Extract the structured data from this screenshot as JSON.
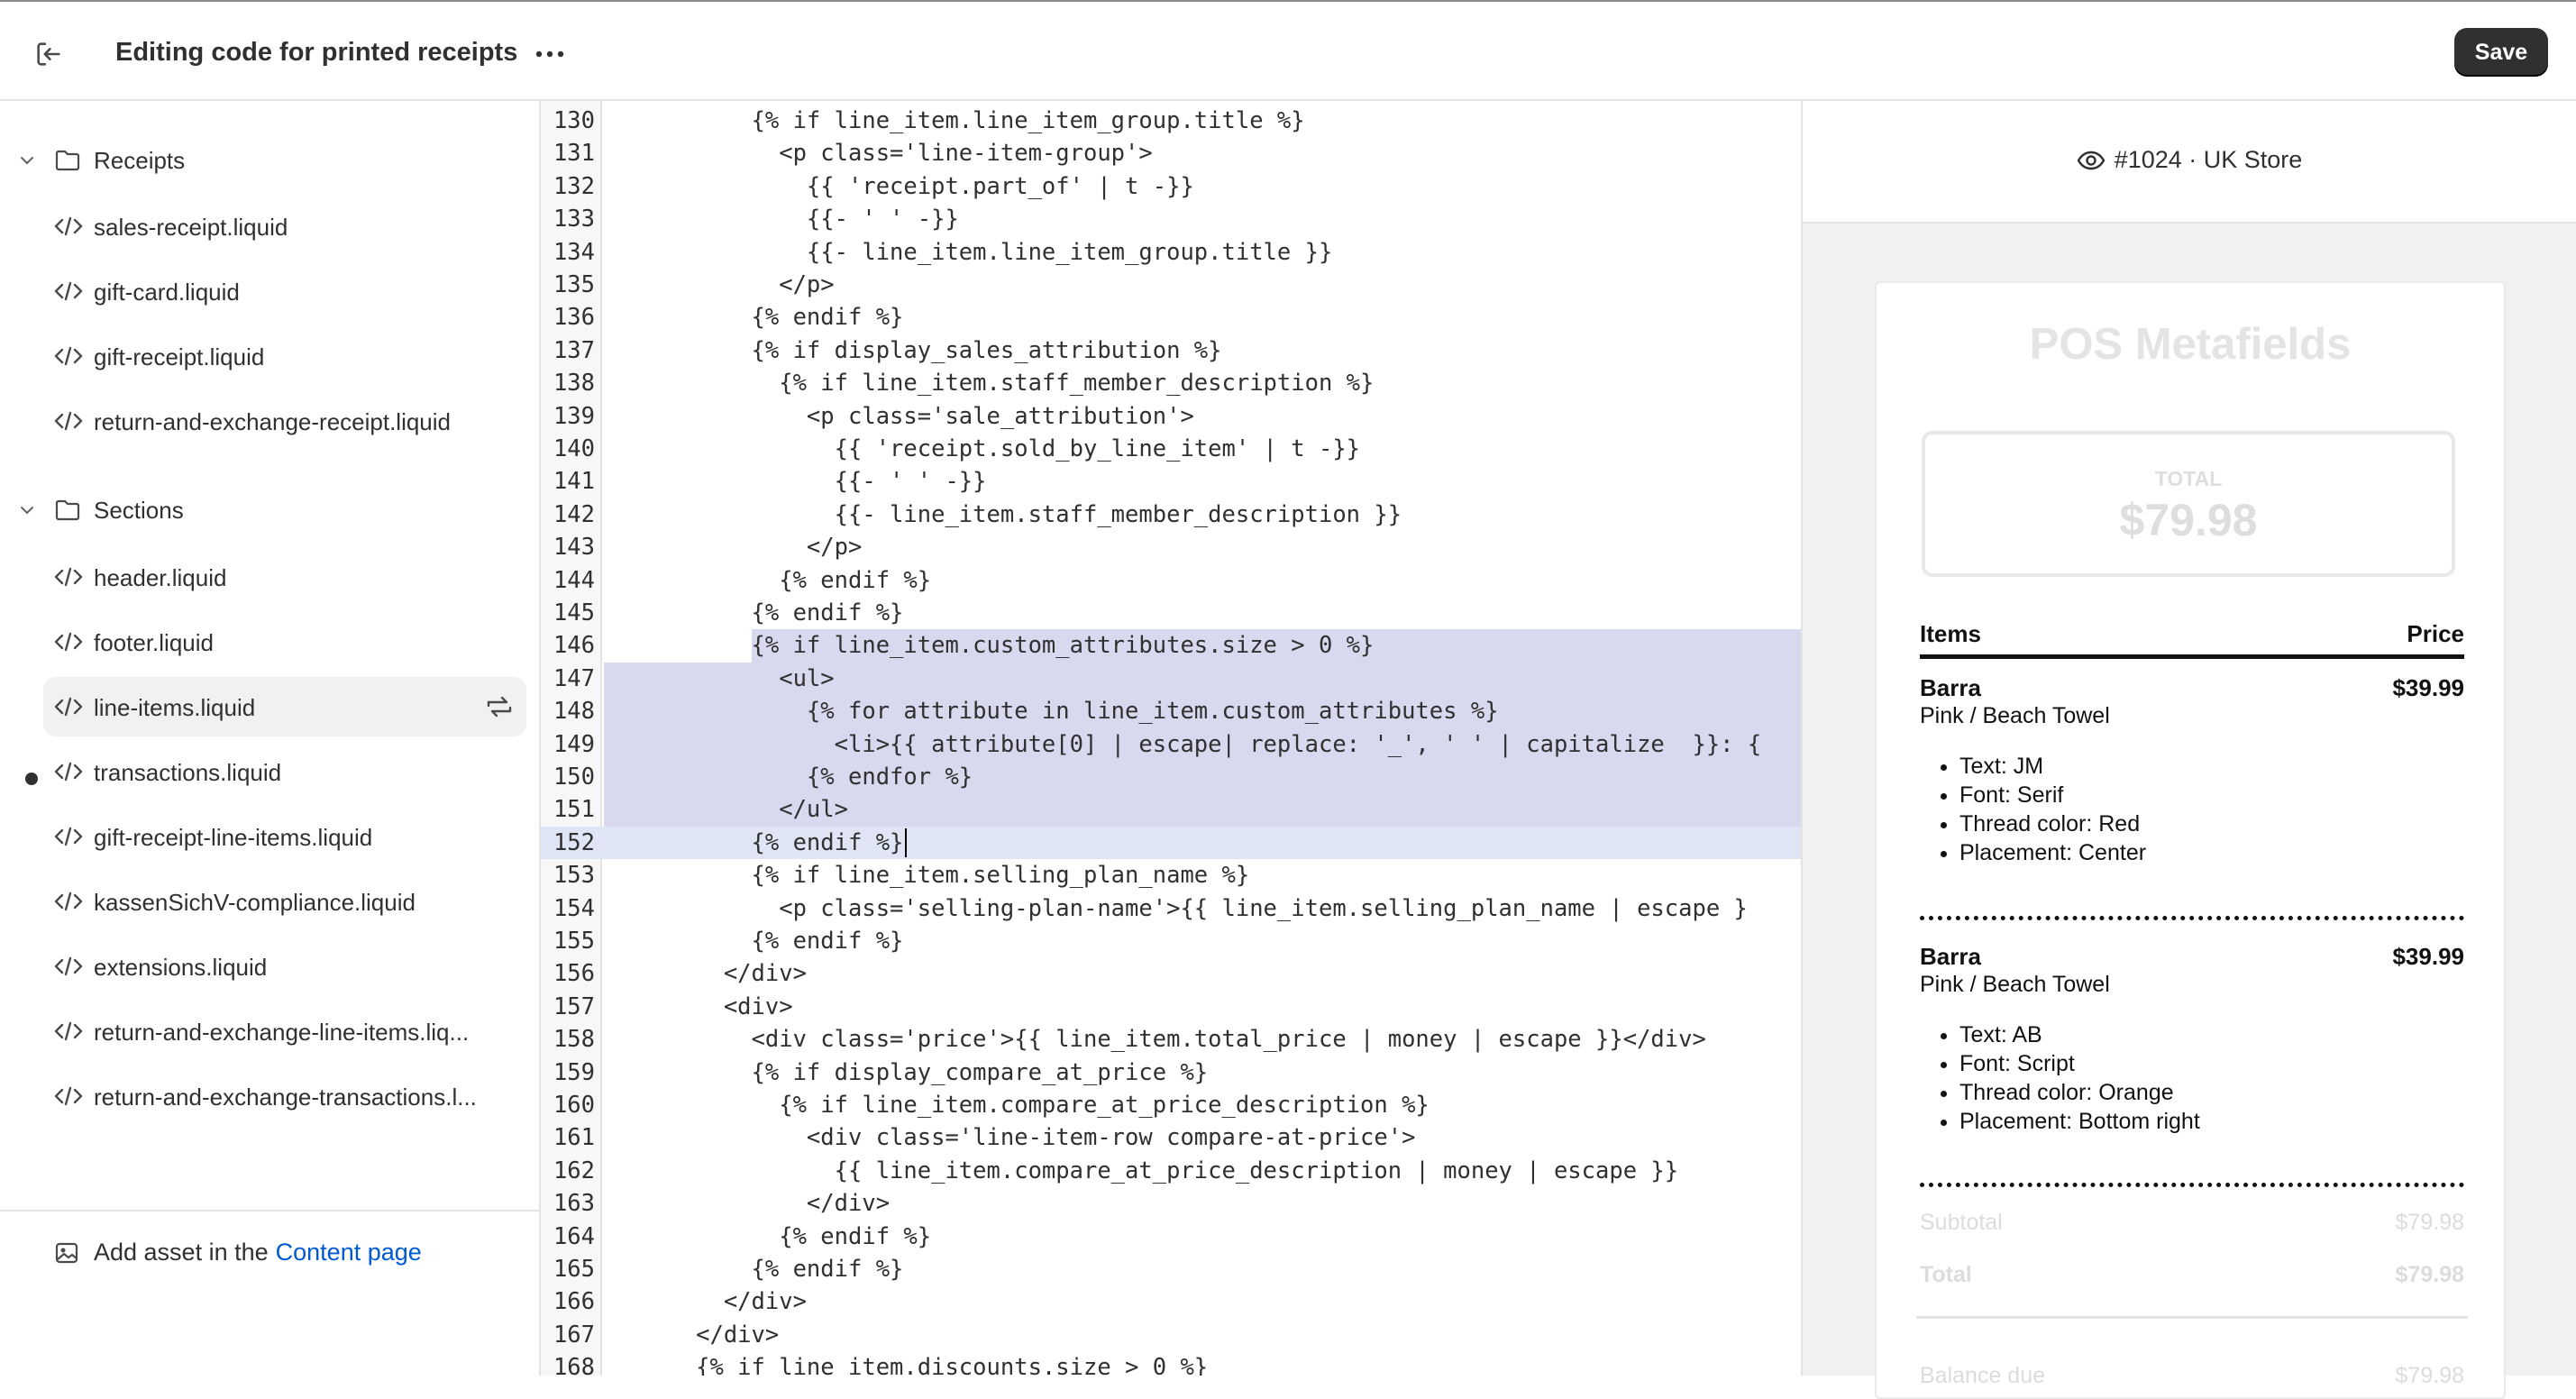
{
  "header": {
    "title": "Editing code for printed receipts",
    "save_label": "Save"
  },
  "sidebar": {
    "folders": [
      {
        "label": "Receipts"
      },
      {
        "label": "Sections"
      }
    ],
    "receipts_files": [
      "sales-receipt.liquid",
      "gift-card.liquid",
      "gift-receipt.liquid",
      "return-and-exchange-receipt.liquid"
    ],
    "sections_files": [
      "header.liquid",
      "footer.liquid",
      "line-items.liquid",
      "transactions.liquid",
      "gift-receipt-line-items.liquid",
      "kassenSichV-compliance.liquid",
      "extensions.liquid",
      "return-and-exchange-line-items.liq...",
      "return-and-exchange-transactions.l..."
    ],
    "active_file": "line-items.liquid",
    "asset_text": "Add asset in the",
    "asset_link": "Content page"
  },
  "editor": {
    "lines": [
      {
        "n": "130",
        "code": "          {% if line_item.line_item_group.title %}"
      },
      {
        "n": "131",
        "code": "            <p class='line-item-group'>"
      },
      {
        "n": "132",
        "code": "              {{ 'receipt.part_of' | t -}}"
      },
      {
        "n": "133",
        "code": "              {{- ' ' -}}"
      },
      {
        "n": "134",
        "code": "              {{- line_item.line_item_group.title }}"
      },
      {
        "n": "135",
        "code": "            </p>"
      },
      {
        "n": "136",
        "code": "          {% endif %}"
      },
      {
        "n": "137",
        "code": "          {% if display_sales_attribution %}"
      },
      {
        "n": "138",
        "code": "            {% if line_item.staff_member_description %}"
      },
      {
        "n": "139",
        "code": "              <p class='sale_attribution'>"
      },
      {
        "n": "140",
        "code": "                {{ 'receipt.sold_by_line_item' | t -}}"
      },
      {
        "n": "141",
        "code": "                {{- ' ' -}}"
      },
      {
        "n": "142",
        "code": "                {{- line_item.staff_member_description }}"
      },
      {
        "n": "143",
        "code": "              </p>"
      },
      {
        "n": "144",
        "code": "            {% endif %}"
      },
      {
        "n": "145",
        "code": "          {% endif %}"
      },
      {
        "n": "146",
        "code": "          {% if line_item.custom_attributes.size > 0 %}"
      },
      {
        "n": "147",
        "code": "            <ul>"
      },
      {
        "n": "148",
        "code": "              {% for attribute in line_item.custom_attributes %}"
      },
      {
        "n": "149",
        "code": "                <li>{{ attribute[0] | escape| replace: '_', ' ' | capitalize  }}: {"
      },
      {
        "n": "150",
        "code": "              {% endfor %}"
      },
      {
        "n": "151",
        "code": "            </ul>"
      },
      {
        "n": "152",
        "code": "          {% endif %}"
      },
      {
        "n": "153",
        "code": "          {% if line_item.selling_plan_name %}"
      },
      {
        "n": "154",
        "code": "            <p class='selling-plan-name'>{{ line_item.selling_plan_name | escape }"
      },
      {
        "n": "155",
        "code": "          {% endif %}"
      },
      {
        "n": "156",
        "code": "        </div>"
      },
      {
        "n": "157",
        "code": "        <div>"
      },
      {
        "n": "158",
        "code": "          <div class='price'>{{ line_item.total_price | money | escape }}</div>"
      },
      {
        "n": "159",
        "code": "          {% if display_compare_at_price %}"
      },
      {
        "n": "160",
        "code": "            {% if line_item.compare_at_price_description %}"
      },
      {
        "n": "161",
        "code": "              <div class='line-item-row compare-at-price'>"
      },
      {
        "n": "162",
        "code": "                {{ line_item.compare_at_price_description | money | escape }}"
      },
      {
        "n": "163",
        "code": "              </div>"
      },
      {
        "n": "164",
        "code": "            {% endif %}"
      },
      {
        "n": "165",
        "code": "          {% endif %}"
      },
      {
        "n": "166",
        "code": "        </div>"
      },
      {
        "n": "167",
        "code": "      </div>"
      },
      {
        "n": "168",
        "code": "      {% if line_item.discounts.size > 0 %}"
      }
    ]
  },
  "preview": {
    "store": "#1024 · UK Store",
    "receipt_title": "POS Metafields",
    "total_label": "TOTAL",
    "total_value": "$79.98",
    "items_header": "Items",
    "price_header": "Price",
    "items": [
      {
        "name": "Barra",
        "price": "$39.99",
        "variant": "Pink / Beach Towel",
        "attrs": [
          "Text: JM",
          "Font: Serif",
          "Thread color: Red",
          "Placement: Center"
        ]
      },
      {
        "name": "Barra",
        "price": "$39.99",
        "variant": "Pink / Beach Towel",
        "attrs": [
          "Text: AB",
          "Font: Script",
          "Thread color: Orange",
          "Placement: Bottom right"
        ]
      }
    ],
    "subtotal_label": "Subtotal",
    "subtotal_value": "$79.98",
    "total2_label": "Total",
    "total2_value": "$79.98",
    "balance_label": "Balance due",
    "balance_value": "$79.98"
  }
}
